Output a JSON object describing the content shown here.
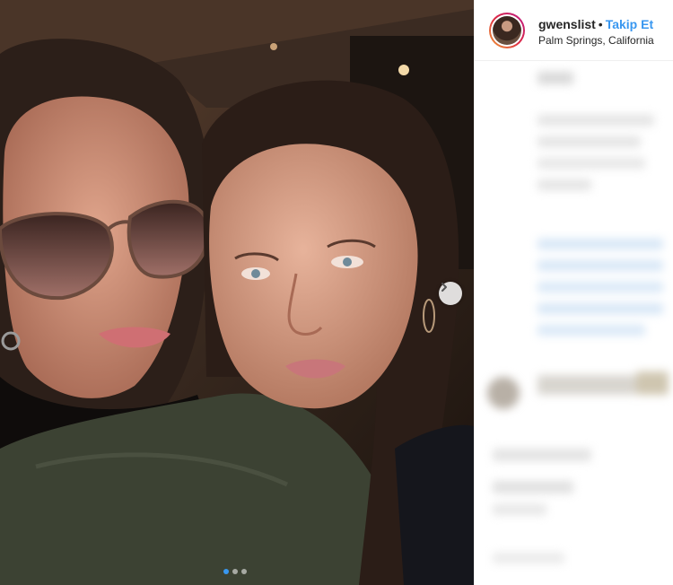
{
  "post": {
    "username": "gwenslist",
    "separator": "•",
    "follow_label": "Takip Et",
    "location": "Palm Springs, California"
  },
  "carousel": {
    "slide_count": 3,
    "active_index": 0,
    "next_icon": "chevron-right-icon"
  },
  "colors": {
    "accent": "#3897f0",
    "text": "#262626",
    "border": "#efefef"
  }
}
